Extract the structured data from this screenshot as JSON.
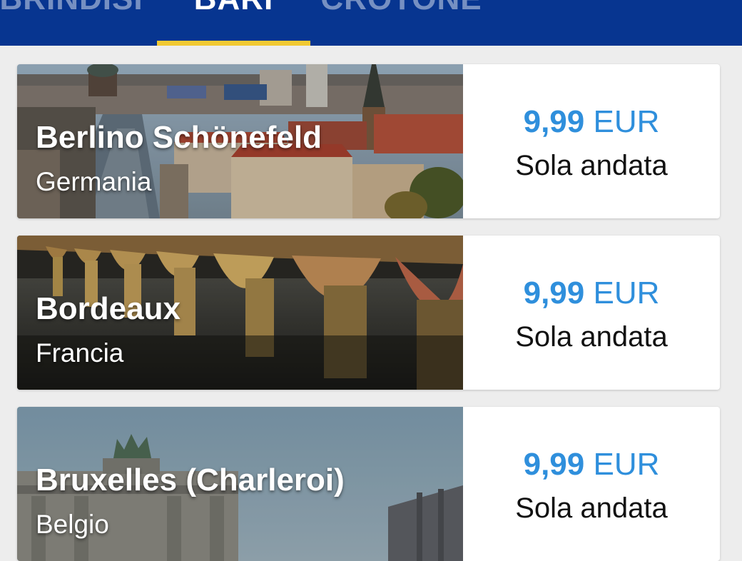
{
  "tabs": [
    {
      "label": "BRINDISI",
      "active": false
    },
    {
      "label": "BARI",
      "active": true
    },
    {
      "label": "CROTONE",
      "active": false
    }
  ],
  "colors": {
    "tabbar": "#073590",
    "indicator": "#f1c933",
    "price": "#2f8fdc"
  },
  "destinations": [
    {
      "name": "Berlino Schönefeld",
      "country": "Germania",
      "price_amount": "9,99",
      "currency": "EUR",
      "trip_type": "Sola andata",
      "image": "berlin-cityscape"
    },
    {
      "name": "Bordeaux",
      "country": "Francia",
      "price_amount": "9,99",
      "currency": "EUR",
      "trip_type": "Sola andata",
      "image": "bordeaux-bridge"
    },
    {
      "name": "Bruxelles (Charleroi)",
      "country": "Belgio",
      "price_amount": "9,99",
      "currency": "EUR",
      "trip_type": "Sola andata",
      "image": "brussels-arch"
    }
  ]
}
